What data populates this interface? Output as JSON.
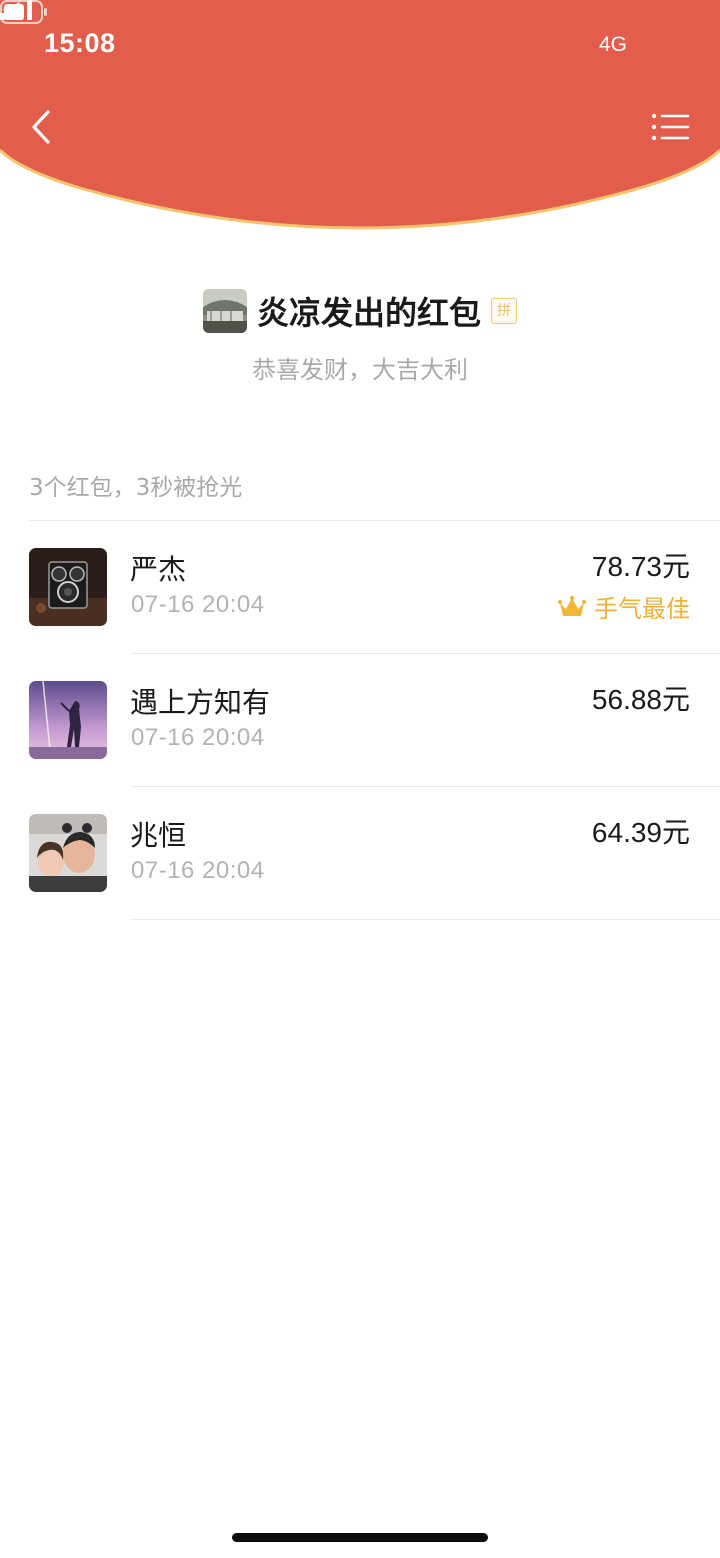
{
  "status_bar": {
    "time": "15:08",
    "network": "4G"
  },
  "header": {
    "accent_color": "#e25d4b",
    "rim_color": "#f4c46e",
    "back_icon": "chevron-left-icon",
    "menu_icon": "list-menu-icon"
  },
  "sender": {
    "title": "炎凉发出的红包",
    "badge": "拼",
    "blessing": "恭喜发财，大吉大利"
  },
  "summary": "3个红包，3秒被抢光",
  "recipients": [
    {
      "name": "严杰",
      "time": "07-16 20:04",
      "amount": "78.73元",
      "best_label": "手气最佳"
    },
    {
      "name": "遇上方知有",
      "time": "07-16 20:04",
      "amount": "56.88元"
    },
    {
      "name": "兆恒",
      "time": "07-16 20:04",
      "amount": "64.39元"
    }
  ]
}
